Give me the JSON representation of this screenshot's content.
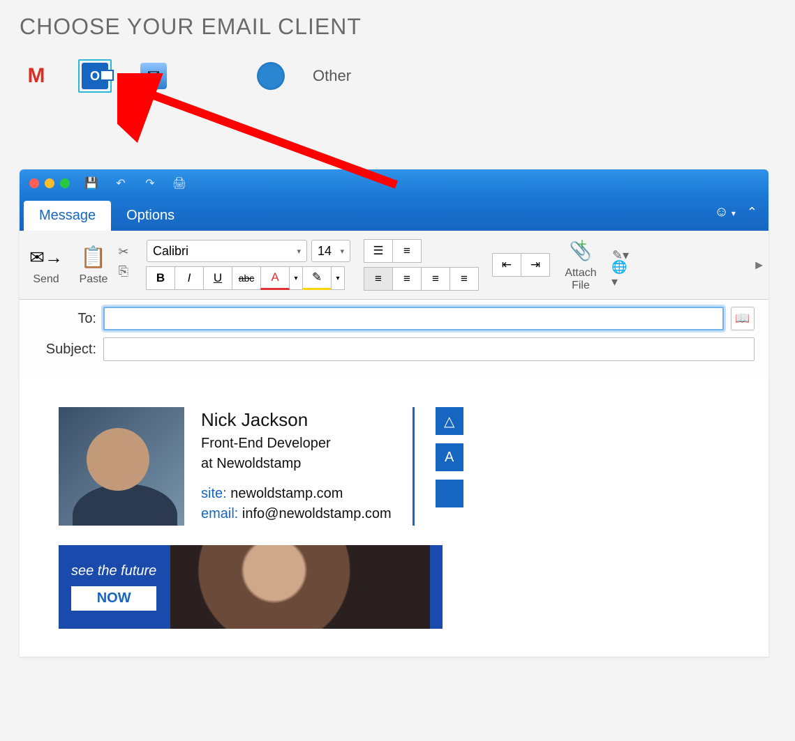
{
  "heading": "CHOOSE YOUR EMAIL CLIENT",
  "clients": {
    "other_label": "Other"
  },
  "tabs": {
    "message": "Message",
    "options": "Options"
  },
  "ribbon": {
    "send": "Send",
    "paste": "Paste",
    "font": "Calibri",
    "size": "14",
    "bold": "B",
    "italic": "I",
    "underline": "U",
    "strike": "abc",
    "fontcolor": "A",
    "attach": "Attach\nFile"
  },
  "fields": {
    "to": "To:",
    "subject": "Subject:"
  },
  "signature": {
    "name": "Nick Jackson",
    "role": "Front-End Developer",
    "company": "at Newoldstamp",
    "site_label": "site:",
    "site_value": "newoldstamp.com",
    "email_label": "email:",
    "email_value": "info@newoldstamp.com"
  },
  "banner": {
    "top": "see the future",
    "cta": "NOW"
  }
}
